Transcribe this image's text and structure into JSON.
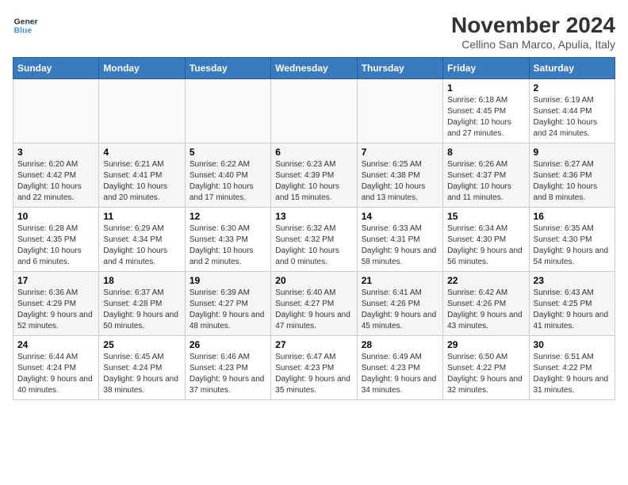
{
  "header": {
    "logo_line1": "General",
    "logo_line2": "Blue",
    "title": "November 2024",
    "subtitle": "Cellino San Marco, Apulia, Italy"
  },
  "columns": [
    "Sunday",
    "Monday",
    "Tuesday",
    "Wednesday",
    "Thursday",
    "Friday",
    "Saturday"
  ],
  "weeks": [
    [
      {
        "day": "",
        "info": ""
      },
      {
        "day": "",
        "info": ""
      },
      {
        "day": "",
        "info": ""
      },
      {
        "day": "",
        "info": ""
      },
      {
        "day": "",
        "info": ""
      },
      {
        "day": "1",
        "info": "Sunrise: 6:18 AM\nSunset: 4:45 PM\nDaylight: 10 hours and 27 minutes."
      },
      {
        "day": "2",
        "info": "Sunrise: 6:19 AM\nSunset: 4:44 PM\nDaylight: 10 hours and 24 minutes."
      }
    ],
    [
      {
        "day": "3",
        "info": "Sunrise: 6:20 AM\nSunset: 4:42 PM\nDaylight: 10 hours and 22 minutes."
      },
      {
        "day": "4",
        "info": "Sunrise: 6:21 AM\nSunset: 4:41 PM\nDaylight: 10 hours and 20 minutes."
      },
      {
        "day": "5",
        "info": "Sunrise: 6:22 AM\nSunset: 4:40 PM\nDaylight: 10 hours and 17 minutes."
      },
      {
        "day": "6",
        "info": "Sunrise: 6:23 AM\nSunset: 4:39 PM\nDaylight: 10 hours and 15 minutes."
      },
      {
        "day": "7",
        "info": "Sunrise: 6:25 AM\nSunset: 4:38 PM\nDaylight: 10 hours and 13 minutes."
      },
      {
        "day": "8",
        "info": "Sunrise: 6:26 AM\nSunset: 4:37 PM\nDaylight: 10 hours and 11 minutes."
      },
      {
        "day": "9",
        "info": "Sunrise: 6:27 AM\nSunset: 4:36 PM\nDaylight: 10 hours and 8 minutes."
      }
    ],
    [
      {
        "day": "10",
        "info": "Sunrise: 6:28 AM\nSunset: 4:35 PM\nDaylight: 10 hours and 6 minutes."
      },
      {
        "day": "11",
        "info": "Sunrise: 6:29 AM\nSunset: 4:34 PM\nDaylight: 10 hours and 4 minutes."
      },
      {
        "day": "12",
        "info": "Sunrise: 6:30 AM\nSunset: 4:33 PM\nDaylight: 10 hours and 2 minutes."
      },
      {
        "day": "13",
        "info": "Sunrise: 6:32 AM\nSunset: 4:32 PM\nDaylight: 10 hours and 0 minutes."
      },
      {
        "day": "14",
        "info": "Sunrise: 6:33 AM\nSunset: 4:31 PM\nDaylight: 9 hours and 58 minutes."
      },
      {
        "day": "15",
        "info": "Sunrise: 6:34 AM\nSunset: 4:30 PM\nDaylight: 9 hours and 56 minutes."
      },
      {
        "day": "16",
        "info": "Sunrise: 6:35 AM\nSunset: 4:30 PM\nDaylight: 9 hours and 54 minutes."
      }
    ],
    [
      {
        "day": "17",
        "info": "Sunrise: 6:36 AM\nSunset: 4:29 PM\nDaylight: 9 hours and 52 minutes."
      },
      {
        "day": "18",
        "info": "Sunrise: 6:37 AM\nSunset: 4:28 PM\nDaylight: 9 hours and 50 minutes."
      },
      {
        "day": "19",
        "info": "Sunrise: 6:39 AM\nSunset: 4:27 PM\nDaylight: 9 hours and 48 minutes."
      },
      {
        "day": "20",
        "info": "Sunrise: 6:40 AM\nSunset: 4:27 PM\nDaylight: 9 hours and 47 minutes."
      },
      {
        "day": "21",
        "info": "Sunrise: 6:41 AM\nSunset: 4:26 PM\nDaylight: 9 hours and 45 minutes."
      },
      {
        "day": "22",
        "info": "Sunrise: 6:42 AM\nSunset: 4:26 PM\nDaylight: 9 hours and 43 minutes."
      },
      {
        "day": "23",
        "info": "Sunrise: 6:43 AM\nSunset: 4:25 PM\nDaylight: 9 hours and 41 minutes."
      }
    ],
    [
      {
        "day": "24",
        "info": "Sunrise: 6:44 AM\nSunset: 4:24 PM\nDaylight: 9 hours and 40 minutes."
      },
      {
        "day": "25",
        "info": "Sunrise: 6:45 AM\nSunset: 4:24 PM\nDaylight: 9 hours and 38 minutes."
      },
      {
        "day": "26",
        "info": "Sunrise: 6:46 AM\nSunset: 4:23 PM\nDaylight: 9 hours and 37 minutes."
      },
      {
        "day": "27",
        "info": "Sunrise: 6:47 AM\nSunset: 4:23 PM\nDaylight: 9 hours and 35 minutes."
      },
      {
        "day": "28",
        "info": "Sunrise: 6:49 AM\nSunset: 4:23 PM\nDaylight: 9 hours and 34 minutes."
      },
      {
        "day": "29",
        "info": "Sunrise: 6:50 AM\nSunset: 4:22 PM\nDaylight: 9 hours and 32 minutes."
      },
      {
        "day": "30",
        "info": "Sunrise: 6:51 AM\nSunset: 4:22 PM\nDaylight: 9 hours and 31 minutes."
      }
    ]
  ]
}
